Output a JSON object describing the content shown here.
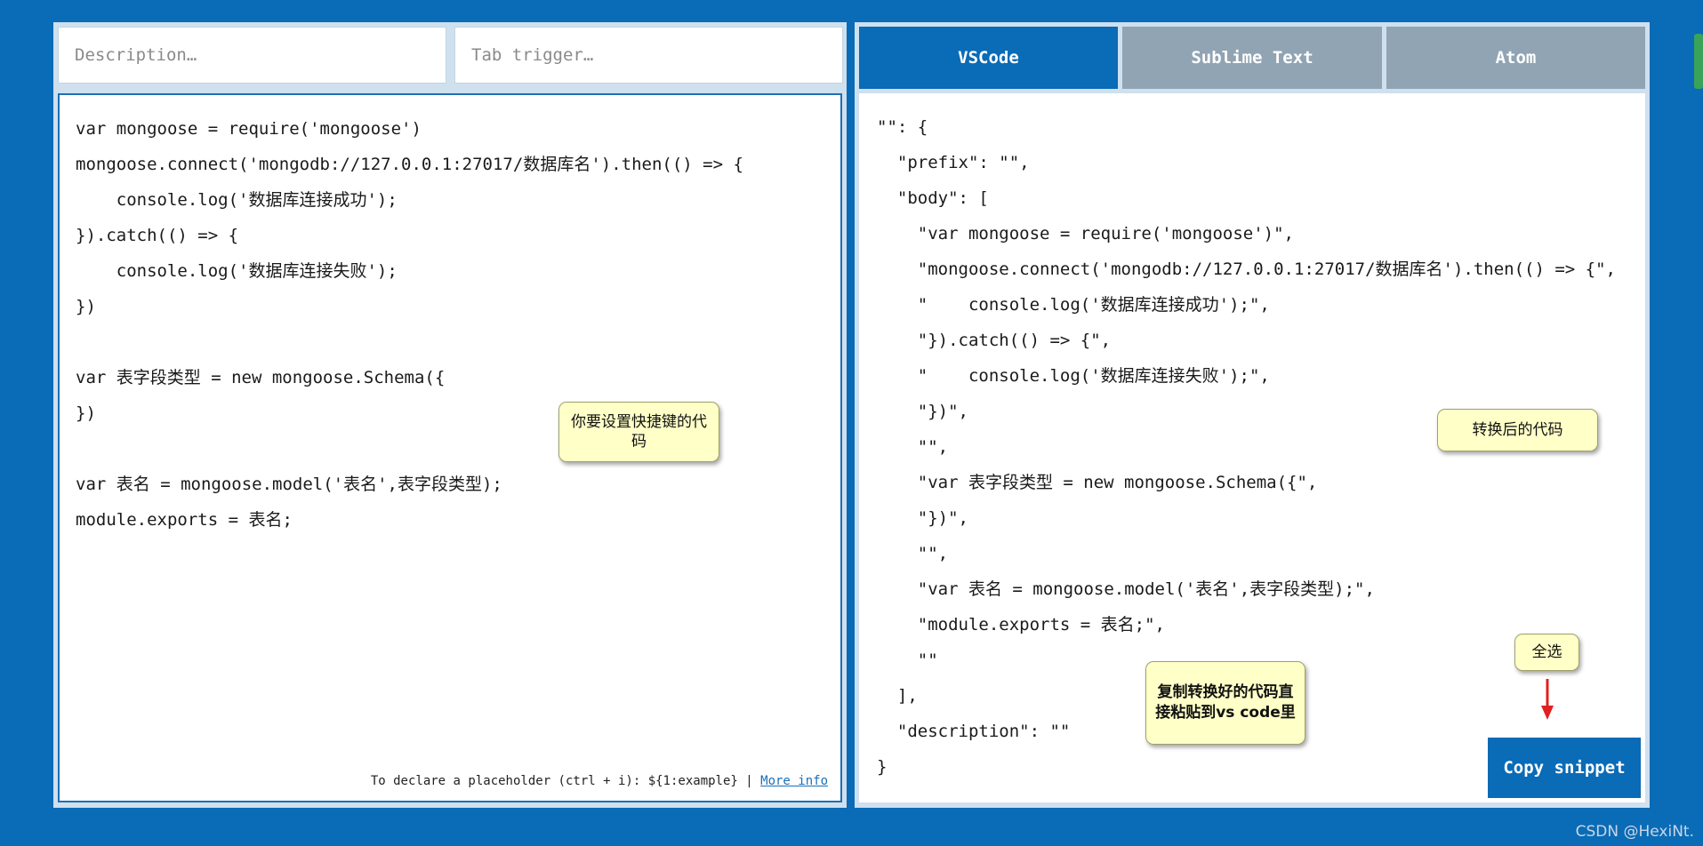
{
  "left": {
    "description_placeholder": "Description…",
    "tab_trigger_placeholder": "Tab trigger…",
    "code_lines": [
      "var mongoose = require('mongoose')",
      "mongoose.connect('mongodb://127.0.0.1:27017/数据库名').then(() => {",
      "    console.log('数据库连接成功');",
      "}).catch(() => {",
      "    console.log('数据库连接失败');",
      "})",
      "",
      "var 表字段类型 = new mongoose.Schema({",
      "})",
      "",
      "var 表名 = mongoose.model('表名',表字段类型);",
      "module.exports = 表名;"
    ],
    "hint_text": "To declare a placeholder (ctrl + i): ${1:example} |",
    "more_info_label": "More info"
  },
  "tabs": [
    {
      "label": "VSCode",
      "active": true
    },
    {
      "label": "Sublime Text",
      "active": false
    },
    {
      "label": "Atom",
      "active": false
    }
  ],
  "output_lines": [
    "\"\": {",
    "  \"prefix\": \"\",",
    "  \"body\": [",
    "    \"var mongoose = require('mongoose')\",",
    "    \"mongoose.connect('mongodb://127.0.0.1:27017/数据库名').then(() => {\",",
    "    \"    console.log('数据库连接成功');\",",
    "    \"}).catch(() => {\",",
    "    \"    console.log('数据库连接失败');\",",
    "    \"})\",",
    "    \"\",",
    "    \"var 表字段类型 = new mongoose.Schema({\",",
    "    \"})\",",
    "    \"\",",
    "    \"var 表名 = mongoose.model('表名',表字段类型);\",",
    "    \"module.exports = 表名;\",",
    "    \"\"",
    "  ],",
    "  \"description\": \"\"",
    "}"
  ],
  "copy_button_label": "Copy snippet",
  "callouts": {
    "left": "你要设置快捷键的代码",
    "right": "转换后的代码",
    "select_all": "全选",
    "copy_note": "复制转换好的代码直接粘贴到vs code里"
  },
  "watermark": "CSDN @HexiNt.",
  "colors": {
    "accent": "#0a6bb6",
    "inactive_tab": "#91a4b3",
    "callout": "#ffffc8",
    "arrow": "#e02020"
  }
}
